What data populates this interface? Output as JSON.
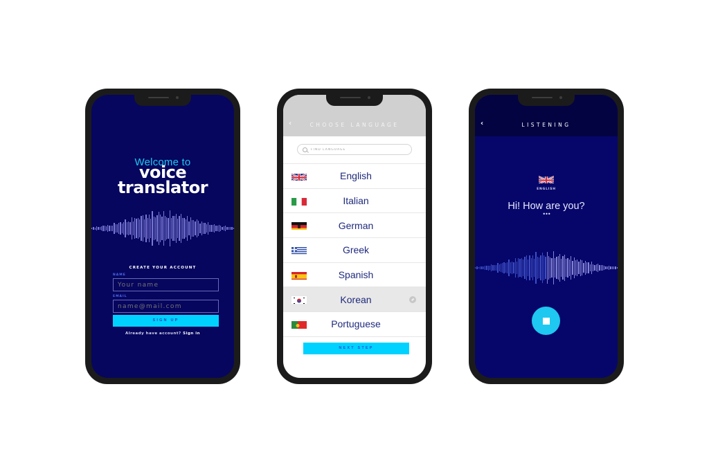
{
  "screens": {
    "welcome": {
      "welcome_text": "Welcome to",
      "brand_line1": "voice",
      "brand_line2": "translator",
      "create_account_title": "CREATE YOUR ACCOUNT",
      "name_label": "NAME",
      "name_placeholder": "Your name",
      "email_label": "EMAIL",
      "email_placeholder": "name@mail.com",
      "signup_label": "SIGN UP",
      "already_text": "Already have account?",
      "signin_link": "Sign in"
    },
    "choose_language": {
      "back_icon": "chevron-left-icon",
      "title": "CHOOSE LANGUAGE",
      "search_placeholder": "FIND LANGUAGE",
      "languages": [
        {
          "name": "English",
          "flag": "uk-flag",
          "selected": false
        },
        {
          "name": "Italian",
          "flag": "italy-flag",
          "selected": false
        },
        {
          "name": "German",
          "flag": "germany-flag",
          "selected": false
        },
        {
          "name": "Greek",
          "flag": "greece-flag",
          "selected": false
        },
        {
          "name": "Spanish",
          "flag": "spain-flag",
          "selected": false
        },
        {
          "name": "Korean",
          "flag": "korea-flag",
          "selected": true
        },
        {
          "name": "Portuguese",
          "flag": "portugal-flag",
          "selected": false
        }
      ],
      "next_label": "NEXT STEP"
    },
    "listening": {
      "back_icon": "chevron-left-icon",
      "title": "LISTENING",
      "language_label": "ENGLISH",
      "phrase": "Hi! How are you?",
      "ellipsis": "•••",
      "stop_icon": "stop-icon"
    }
  },
  "colors": {
    "navy": "#06065e",
    "cyan": "#00d2ff",
    "text_blue": "#1f2a7c",
    "header_gray": "#d0d0d0"
  }
}
